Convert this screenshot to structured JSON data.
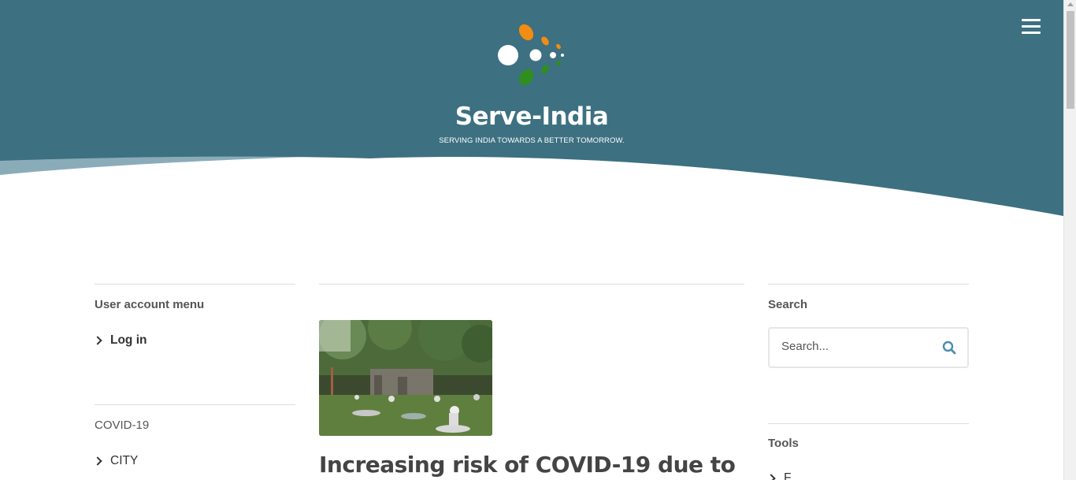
{
  "header": {
    "site_name": "Serve-India",
    "slogan": "SERVING INDIA TOWARDS A BETTER TOMORROW.",
    "colors": {
      "header_bg": "#3d7081",
      "wave_light": "#8aacb8",
      "logo_orange": "#f28c12",
      "logo_green": "#2f8f1e",
      "logo_white": "#ffffff"
    },
    "menu_icon": "hamburger-icon"
  },
  "left_sidebar": {
    "user_menu": {
      "title": "User account menu",
      "items": [
        {
          "label": "Log in"
        }
      ]
    },
    "covid_menu": {
      "title": "COVID-19",
      "items": [
        {
          "label": "CITY"
        }
      ]
    }
  },
  "main": {
    "article": {
      "title": "Increasing risk of COVID-19 due to",
      "image_alt": "People resting on grass in a park"
    }
  },
  "right_sidebar": {
    "search": {
      "title": "Search",
      "placeholder": "Search...",
      "icon": "search-icon"
    },
    "tools": {
      "title": "Tools",
      "items": [
        {
          "label": "F"
        }
      ]
    }
  }
}
